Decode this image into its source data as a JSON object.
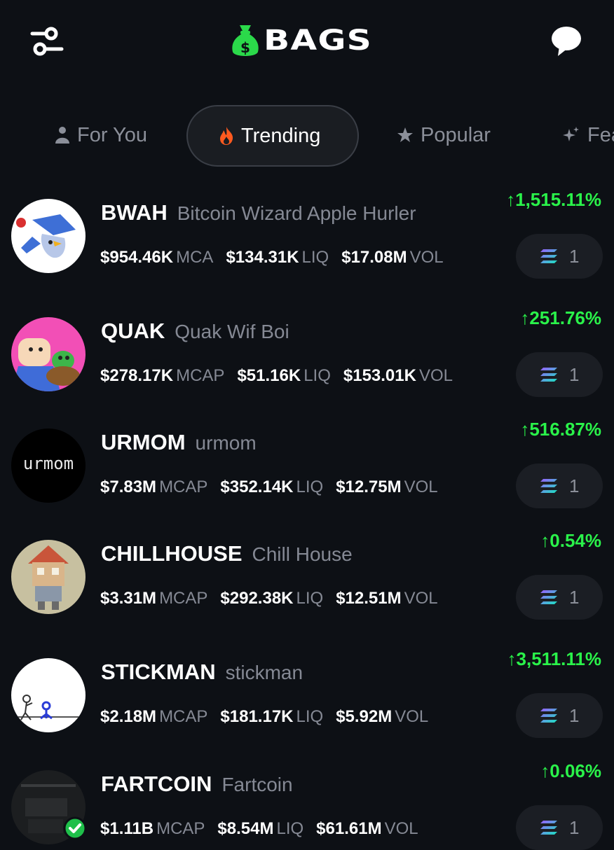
{
  "app": {
    "name": "BAGS"
  },
  "header": {
    "logo_text": "BAGS"
  },
  "tabs": [
    {
      "label": "For You",
      "icon": "person-icon",
      "active": false
    },
    {
      "label": "Trending",
      "icon": "fire-icon",
      "active": true
    },
    {
      "label": "Popular",
      "icon": "star-icon",
      "active": false
    },
    {
      "label": "Fea",
      "icon": "sparkle-icon",
      "active": false
    }
  ],
  "tokens": [
    {
      "ticker": "BWAH",
      "name": "Bitcoin Wizard Apple Hurler",
      "mcap": "$954.46K",
      "mcap_label": "MCA",
      "liq": "$134.31K",
      "liq_label": "LIQ",
      "vol": "$17.08M",
      "vol_label": "VOL",
      "change": "↑1,515.11%",
      "holders": "1"
    },
    {
      "ticker": "QUAK",
      "name": "Quak Wif Boi",
      "mcap": "$278.17K",
      "mcap_label": "MCAP",
      "liq": "$51.16K",
      "liq_label": "LIQ",
      "vol": "$153.01K",
      "vol_label": "VOL",
      "change": "↑251.76%",
      "holders": "1"
    },
    {
      "ticker": "URMOM",
      "name": "urmom",
      "mcap": "$7.83M",
      "mcap_label": "MCAP",
      "liq": "$352.14K",
      "liq_label": "LIQ",
      "vol": "$12.75M",
      "vol_label": "VOL",
      "change": "↑516.87%",
      "holders": "1",
      "avatar_text": "urmom"
    },
    {
      "ticker": "CHILLHOUSE",
      "name": "Chill House",
      "mcap": "$3.31M",
      "mcap_label": "MCAP",
      "liq": "$292.38K",
      "liq_label": "LIQ",
      "vol": "$12.51M",
      "vol_label": "VOL",
      "change": "↑0.54%",
      "holders": "1"
    },
    {
      "ticker": "STICKMAN",
      "name": "stickman",
      "mcap": "$2.18M",
      "mcap_label": "MCAP",
      "liq": "$181.17K",
      "liq_label": "LIQ",
      "vol": "$5.92M",
      "vol_label": "VOL",
      "change": "↑3,511.11%",
      "holders": "1"
    },
    {
      "ticker": "FARTCOIN",
      "name": "Fartcoin",
      "mcap": "$1.11B",
      "mcap_label": "MCAP",
      "liq": "$8.54M",
      "liq_label": "LIQ",
      "vol": "$61.61M",
      "vol_label": "VOL",
      "change": "↑0.06%",
      "holders": "1",
      "verified": true
    }
  ],
  "colors": {
    "background": "#0d1015",
    "positive": "#2af24a",
    "brand": "#2bd94a",
    "muted": "#858994"
  }
}
